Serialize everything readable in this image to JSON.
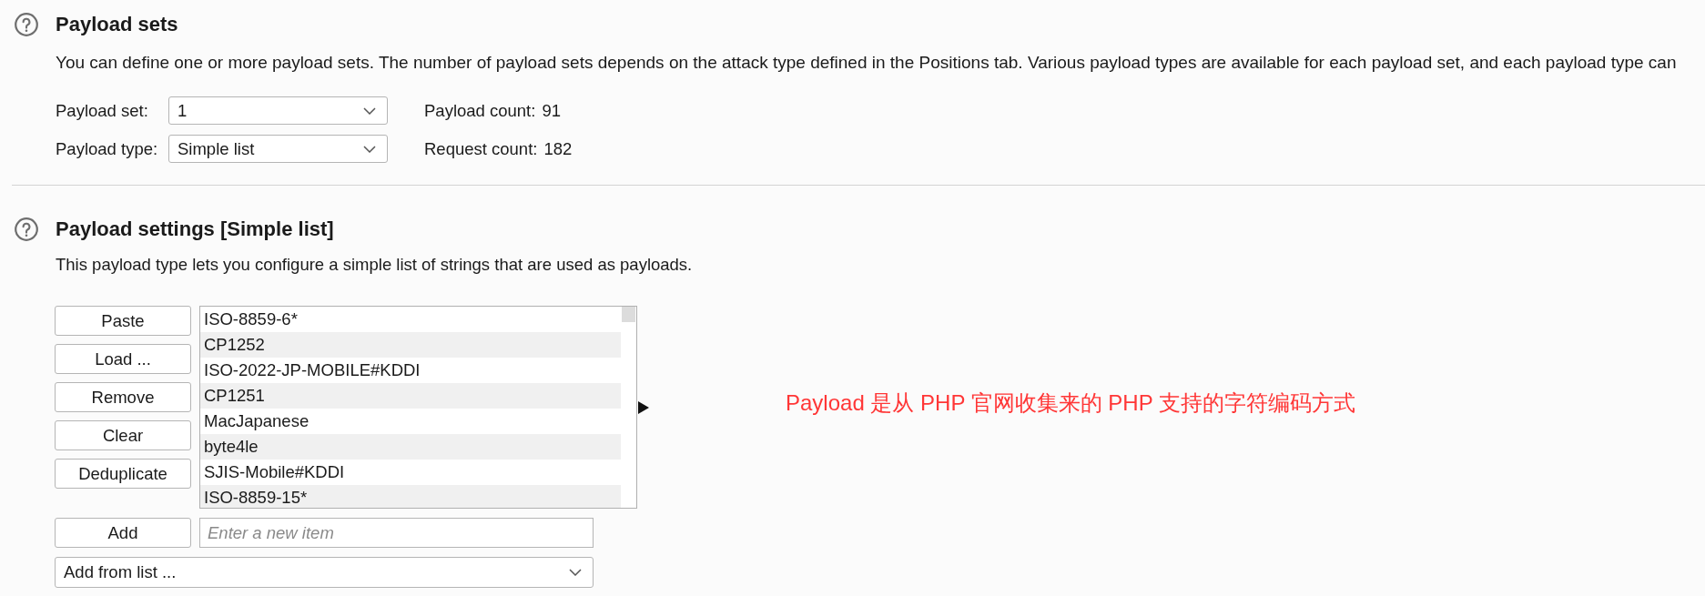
{
  "payload_sets": {
    "title": "Payload sets",
    "description": "You can define one or more payload sets. The number of payload sets depends on the attack type defined in the Positions tab. Various payload types are available for each payload set, and each payload type can",
    "payload_set": {
      "label": "Payload set:",
      "value": "1"
    },
    "payload_count": {
      "label": "Payload count:",
      "value": "91"
    },
    "payload_type": {
      "label": "Payload type:",
      "value": "Simple list"
    },
    "request_count": {
      "label": "Request count:",
      "value": "182"
    }
  },
  "payload_settings": {
    "title": "Payload settings [Simple list]",
    "description": "This payload type lets you configure a simple list of strings that are used as payloads.",
    "buttons": [
      "Paste",
      "Load ...",
      "Remove",
      "Clear",
      "Deduplicate"
    ],
    "items": [
      "ISO-8859-6*",
      "CP1252",
      "ISO-2022-JP-MOBILE#KDDI",
      "CP1251",
      "MacJapanese",
      "byte4le",
      "SJIS-Mobile#KDDI",
      "ISO-8859-15*"
    ],
    "add_button": "Add",
    "new_item": {
      "placeholder": "Enter a new item"
    },
    "add_from_list": {
      "value": "Add from list ..."
    }
  },
  "annotation": "Payload 是从 PHP 官网收集来的 PHP 支持的字符编码方式"
}
